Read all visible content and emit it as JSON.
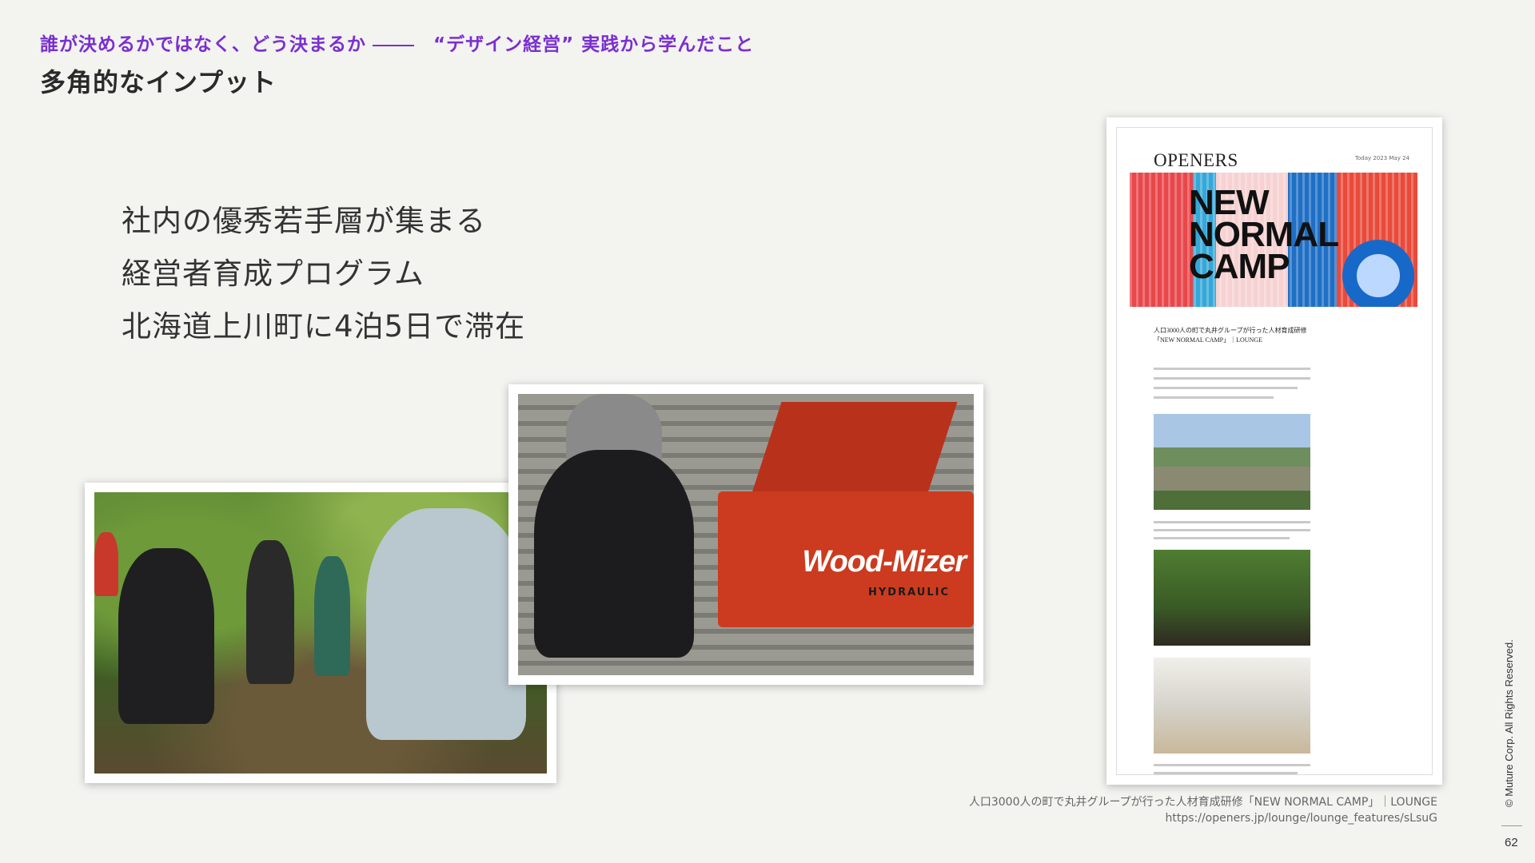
{
  "header": {
    "kicker_left": "誰が決めるかではなく、どう決まるか",
    "kicker_right": "“デザイン経営” 実践から学んだこと",
    "title": "多角的なインプット"
  },
  "bullets": [
    "社内の優秀若手層が集まる",
    "経営者育成プログラム",
    "北海道上川町に4泊5日で滞在"
  ],
  "photos": {
    "right_machine_label": "Wood-Mizer",
    "right_machine_sub": "HYDRAULIC"
  },
  "article": {
    "brand": "OPENERS",
    "date": "Today 2023 May 24",
    "hero_line1": "NEW",
    "hero_line2": "NORMAL",
    "hero_line3": "CAMP",
    "headline": "人口3000人の町で丸井グループが行った人材育成研修「NEW NORMAL CAMP」｜LOUNGE"
  },
  "caption": {
    "line1": "人口3000人の町で丸井グループが行った人材育成研修「NEW NORMAL CAMP」｜LOUNGE",
    "line2": "https://openers.jp/lounge/lounge_features/sLsuG"
  },
  "footer": {
    "copyright": "© Muture Corp. All Rights Reserved.",
    "page_number": "62"
  },
  "colors": {
    "accent": "#7a2fd0",
    "background": "#f3f3f0"
  }
}
